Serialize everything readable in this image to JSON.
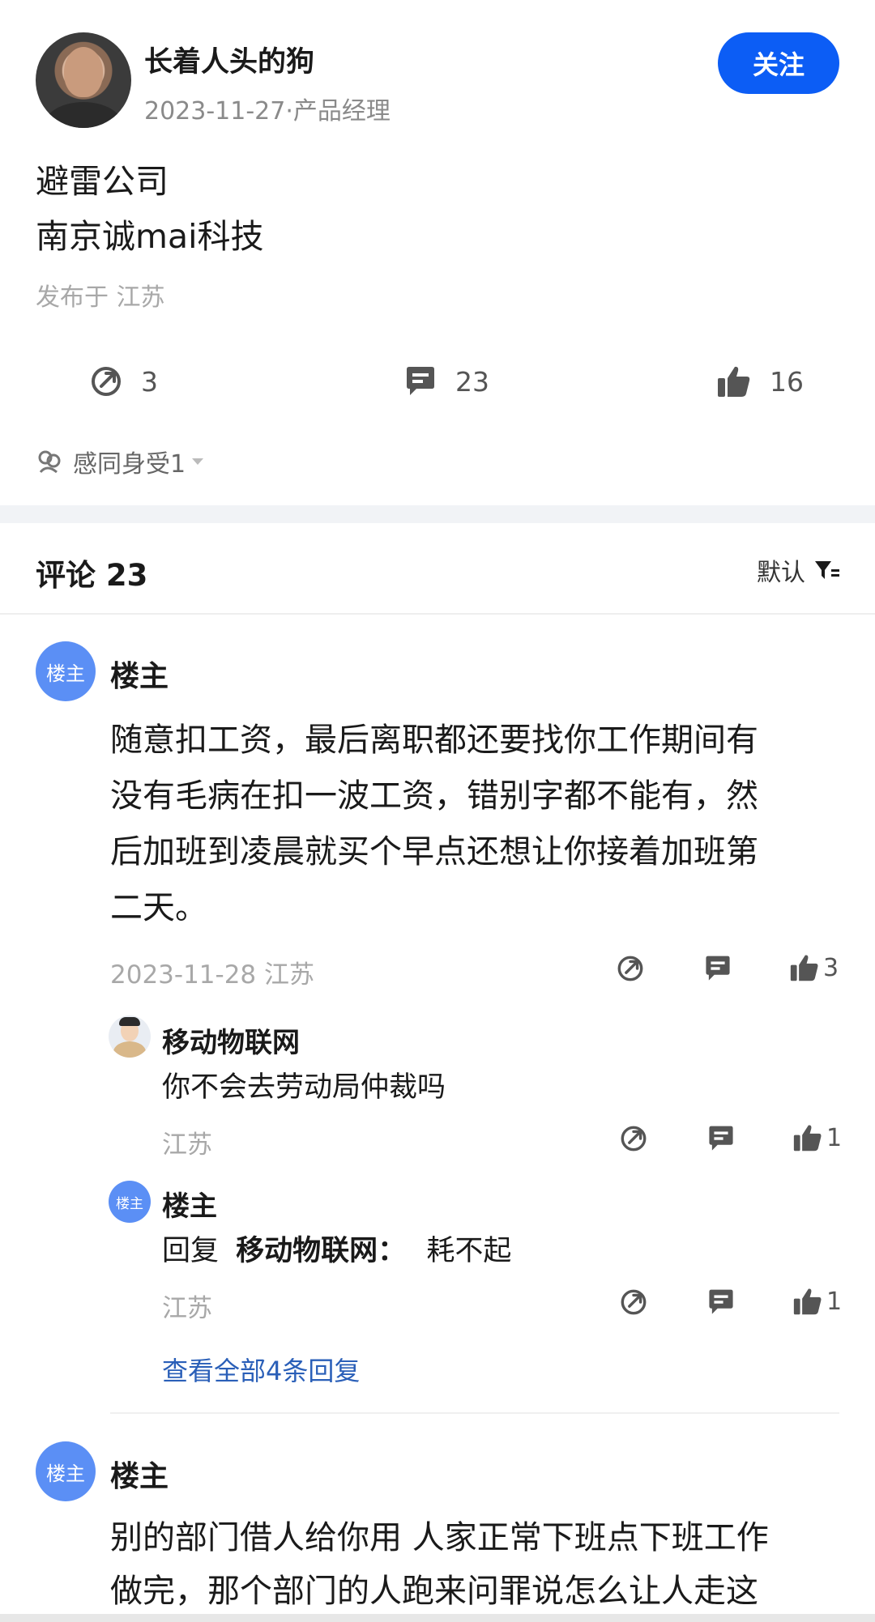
{
  "post": {
    "author": "长着人头的狗",
    "meta": "2023-11-27·产品经理",
    "follow_label": "关注",
    "lines": [
      "避雷公司",
      "南京诚mai科技"
    ],
    "location": "发布于 江苏",
    "stats": {
      "share": "3",
      "comments": "23",
      "likes": "16"
    },
    "feel": "感同身受1"
  },
  "comments_section": {
    "title": "评论 23",
    "sort_label": "默认"
  },
  "comments": [
    {
      "avatar_label": "楼主",
      "name": "楼主",
      "lines": [
        "随意扣工资，最后离职都还要找你工作期间有",
        "没有毛病在扣一波工资，错别字都不能有，然",
        "后加班到凌晨就买个早点还想让你接着加班第",
        "二天。"
      ],
      "meta": "2023-11-28  江苏",
      "likes": "3",
      "replies": [
        {
          "name": "移动物联网",
          "text": "你不会去劳动局仲裁吗",
          "meta": "江苏",
          "likes": "1"
        },
        {
          "avatar_label": "楼主",
          "name": "楼主",
          "reply_prefix": "回复",
          "reply_to": "移动物联网：",
          "text": "耗不起",
          "meta": "江苏",
          "likes": "1"
        }
      ],
      "view_all": "查看全部4条回复"
    },
    {
      "avatar_label": "楼主",
      "name": "楼主",
      "lines": [
        "别的部门借人给你用 人家正常下班点下班工作",
        "做完，那个部门的人跑来问罪说怎么让人走这"
      ]
    }
  ],
  "icons": {
    "accent": "#0c5df5",
    "badge": "#5b8ff5"
  }
}
